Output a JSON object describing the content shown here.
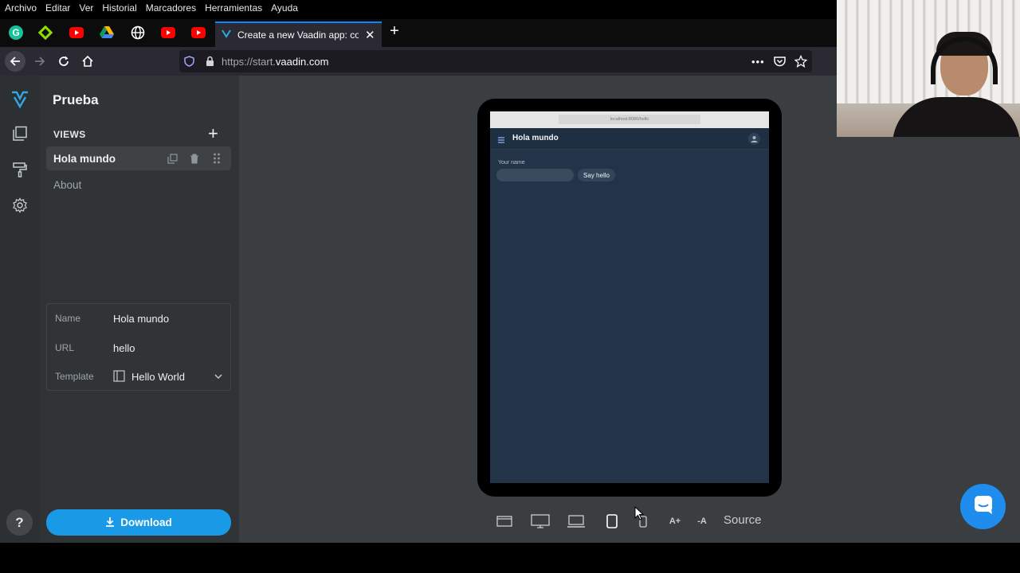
{
  "menubar": {
    "items": [
      "Archivo",
      "Editar",
      "Ver",
      "Historial",
      "Marcadores",
      "Herramientas",
      "Ayuda"
    ]
  },
  "tabs": {
    "active_title": "Create a new Vaadin app: confi",
    "pinned_icons": [
      "grammarly-icon",
      "green-diamond-icon",
      "youtube-icon",
      "google-drive-icon",
      "globe-icon",
      "youtube-icon",
      "youtube-icon"
    ]
  },
  "navbar": {
    "url_prefix": "https://start.",
    "url_domain": "vaadin.com"
  },
  "sidebar": {
    "project_title": "Prueba",
    "views_label": "VIEWS",
    "add_symbol": "+",
    "views": [
      {
        "label": "Hola mundo",
        "selected": true
      },
      {
        "label": "About",
        "selected": false
      }
    ]
  },
  "properties": {
    "name_label": "Name",
    "name_value": "Hola mundo",
    "url_label": "URL",
    "url_value": "hello",
    "template_label": "Template",
    "template_value": "Hello World"
  },
  "download_label": "Download",
  "help_label": "?",
  "preview": {
    "address": "localhost:8080/hello",
    "app_title": "Hola mundo",
    "field_label": "Your name",
    "button_label": "Say hello"
  },
  "toolbar": {
    "font_increase": "A+",
    "font_decrease": "-A",
    "source_label": "Source"
  },
  "colors": {
    "accent": "#1a9ae6",
    "app_background": "#3a3e40",
    "panel": "#303436",
    "preview_bg": "#233448"
  }
}
